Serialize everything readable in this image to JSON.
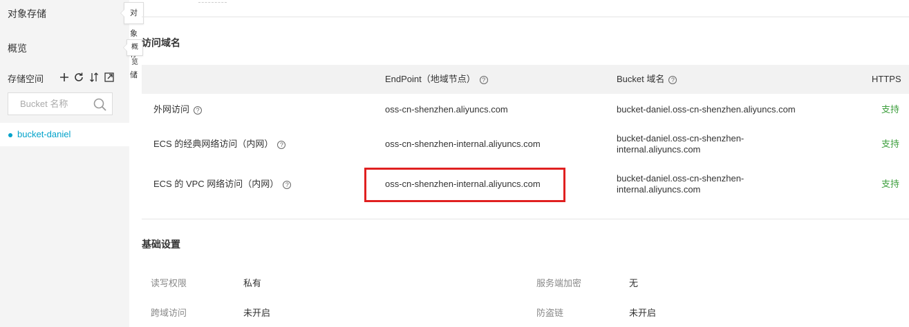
{
  "sidebar": {
    "title": "对象存储",
    "title_tooltip": "对象存储",
    "overview": "概览",
    "overview_tooltip": "概览",
    "storage_label": "存储空间",
    "search_placeholder": "Bucket 名称",
    "buckets": [
      "bucket-daniel"
    ]
  },
  "access_section": {
    "title": "访问域名",
    "headers": {
      "endpoint": "EndPoint（地域节点）",
      "bucket_domain": "Bucket 域名",
      "https": "HTTPS"
    },
    "rows": [
      {
        "type": "外网访问",
        "endpoint": "oss-cn-shenzhen.aliyuncs.com",
        "domain_line1": "bucket-daniel.oss-cn-shenzhen.aliyuncs.com",
        "domain_line2": "",
        "https": "支持"
      },
      {
        "type": "ECS 的经典网络访问（内网）",
        "endpoint": "oss-cn-shenzhen-internal.aliyuncs.com",
        "domain_line1": "bucket-daniel.oss-cn-shenzhen-",
        "domain_line2": "internal.aliyuncs.com",
        "https": "支持"
      },
      {
        "type": "ECS 的 VPC 网络访问（内网）",
        "endpoint": "oss-cn-shenzhen-internal.aliyuncs.com",
        "domain_line1": "bucket-daniel.oss-cn-shenzhen-",
        "domain_line2": "internal.aliyuncs.com",
        "https": "支持"
      }
    ]
  },
  "basic_section": {
    "title": "基础设置",
    "items": [
      {
        "label": "读写权限",
        "value": "私有"
      },
      {
        "label": "服务端加密",
        "value": "无"
      },
      {
        "label": "跨域访问",
        "value": "未开启"
      },
      {
        "label": "防盗链",
        "value": "未开启"
      }
    ]
  },
  "colors": {
    "accent": "#00a2ca",
    "supported": "#3c9e3c",
    "highlight": "#e02020"
  },
  "icons": [
    "plus-icon",
    "refresh-icon",
    "sort-icon",
    "external-link-icon",
    "search-icon",
    "help-icon"
  ]
}
